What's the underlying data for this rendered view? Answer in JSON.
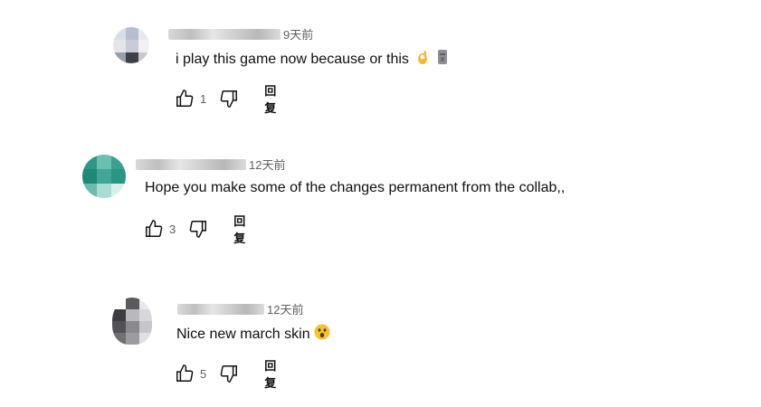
{
  "comments": [
    {
      "author": "",
      "time": "9天前",
      "text": "i play this game now because or this",
      "emojis": [
        "ok-hand-emoji",
        "moai-emoji"
      ],
      "likes": "1",
      "reply_label": "回复"
    },
    {
      "author": "",
      "time": "12天前",
      "text": "Hope you make some of the changes permanent from the collab,,",
      "emojis": [],
      "likes": "3",
      "reply_label": "回复"
    },
    {
      "author": "",
      "time": "12天前",
      "text": "Nice new march skin",
      "emojis": [
        "astonished-face-emoji"
      ],
      "likes": "5",
      "reply_label": "回复"
    }
  ],
  "icons": {
    "like": "thumbs-up-icon",
    "dislike": "thumbs-down-icon"
  },
  "colors": {
    "text": "#0f0f0f",
    "meta": "#606060"
  }
}
